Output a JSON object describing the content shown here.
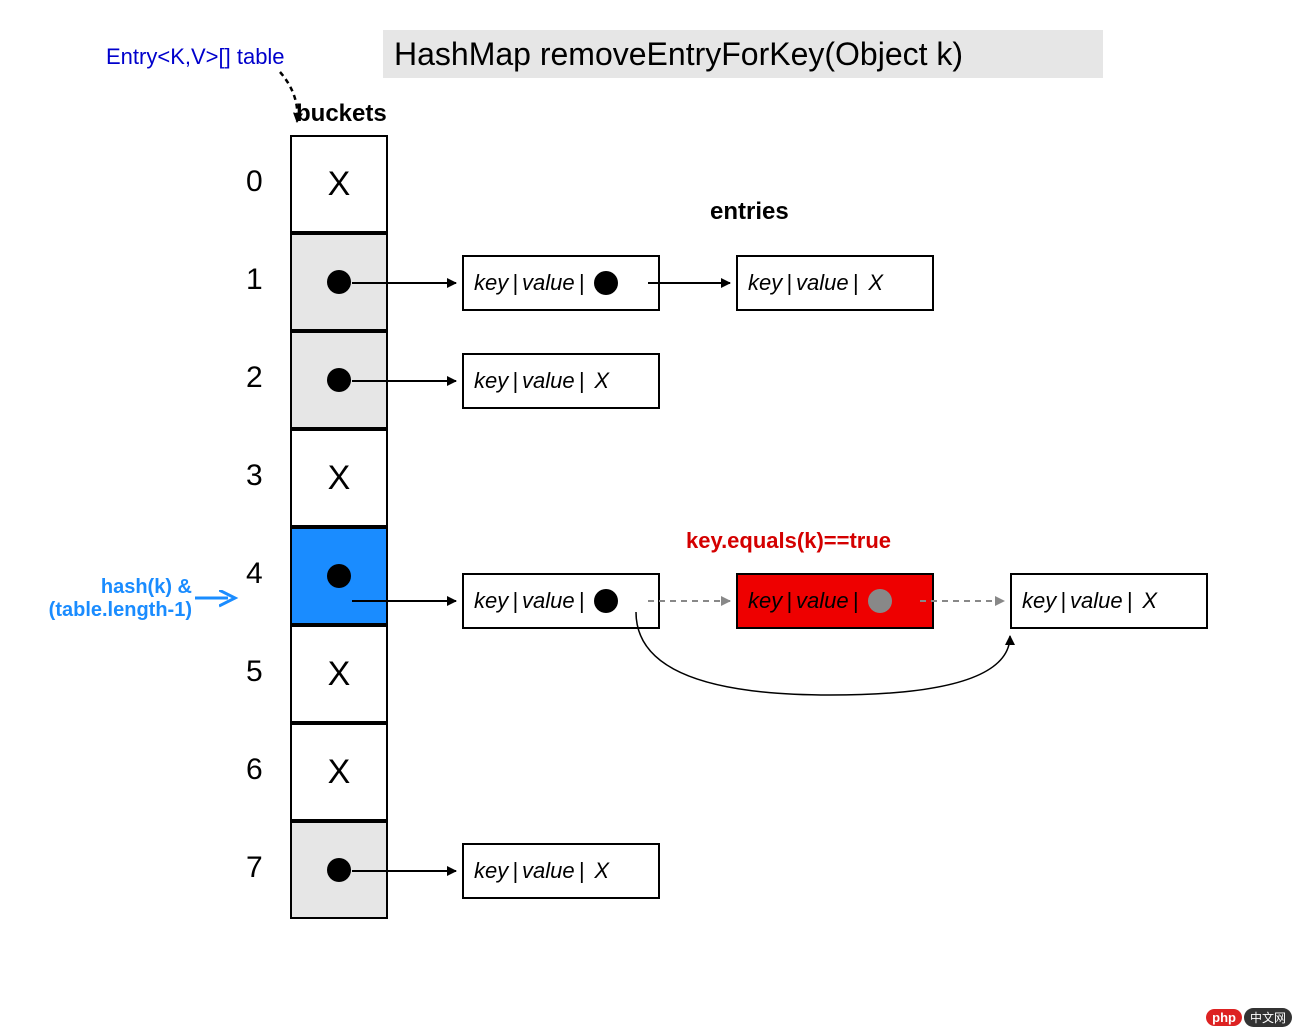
{
  "title": "HashMap removeEntryForKey(Object k)",
  "table_label": "Entry<K,V>[] table",
  "buckets_label": "buckets",
  "entries_label": "entries",
  "hash_label_line1": "hash(k) &",
  "hash_label_line2": "(table.length-1)",
  "equals_label": "key.equals(k)==true",
  "buckets": [
    {
      "index": "0",
      "content": "X",
      "style": "white"
    },
    {
      "index": "1",
      "content": "dot",
      "style": "grey"
    },
    {
      "index": "2",
      "content": "dot",
      "style": "grey"
    },
    {
      "index": "3",
      "content": "X",
      "style": "white"
    },
    {
      "index": "4",
      "content": "dot",
      "style": "blue"
    },
    {
      "index": "5",
      "content": "X",
      "style": "white"
    },
    {
      "index": "6",
      "content": "X",
      "style": "white"
    },
    {
      "index": "7",
      "content": "dot",
      "style": "grey"
    }
  ],
  "entry_key": "key",
  "entry_value": "value",
  "entry_null": "X",
  "watermark_php": "php",
  "watermark_cn": "中文网"
}
